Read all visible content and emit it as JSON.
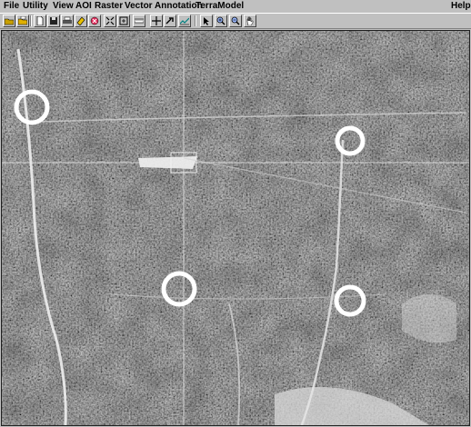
{
  "menu": {
    "file": "File",
    "utility": "Utility",
    "view": "View",
    "aoi": "AOI",
    "raster": "Raster",
    "vector": "Vector",
    "annotation": "Annotation",
    "terramodel": "TerraModel",
    "help": "Help"
  },
  "toolbar": {
    "tools": [
      "open-folder-icon",
      "save-icon",
      "new-document-icon",
      "save-as-icon",
      "print-icon",
      "eraser-icon",
      "cancel-icon",
      "fit-extent-icon",
      "zoom-extent-icon",
      "measure-icon",
      "crosshair-icon",
      "inquire-icon",
      "profile-icon",
      "select-arrow-icon",
      "zoom-in-icon",
      "zoom-out-icon",
      "pan-hand-icon"
    ]
  },
  "viewer": {
    "image_kind": "panchromatic satellite image (grayscale)",
    "marked_features_count": 5
  }
}
